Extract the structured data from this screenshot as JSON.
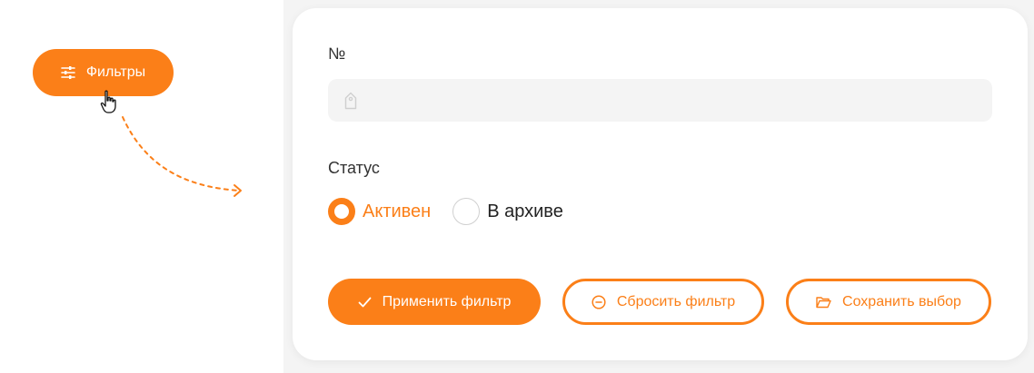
{
  "filter_button": {
    "label": "Фильтры",
    "icon": "sliders-icon"
  },
  "form": {
    "number_label": "№",
    "number_value": "",
    "number_icon": "tag-icon",
    "status_label": "Статус",
    "status_options": [
      {
        "label": "Активен",
        "checked": true
      },
      {
        "label": "В архиве",
        "checked": false
      }
    ]
  },
  "actions": {
    "apply": "Применить фильтр",
    "reset": "Сбросить фильтр",
    "save": "Сохранить выбор"
  },
  "colors": {
    "accent": "#fb7f18",
    "field_bg": "#f4f4f4"
  }
}
